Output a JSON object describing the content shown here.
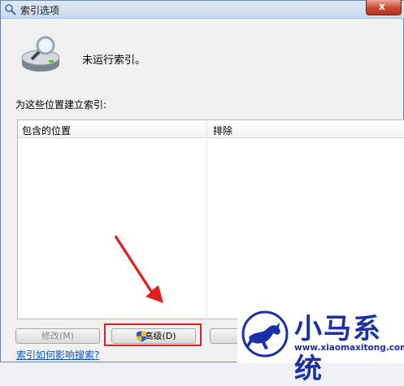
{
  "window": {
    "title": "索引选项",
    "close_glyph": "x"
  },
  "status": {
    "text": "未运行索引。",
    "icon": "drive-search-icon"
  },
  "locations": {
    "label": "为这些位置建立索引:",
    "columns": {
      "included": "包含的位置",
      "excluded": "排除"
    },
    "rows": []
  },
  "buttons": {
    "modify": "修改(M)",
    "advanced": "高级(D)",
    "third": ""
  },
  "links": {
    "help": "索引如何影响搜索?"
  },
  "annotation": {
    "highlight_color": "#e0201d"
  },
  "watermark": {
    "title": "小马系统",
    "url": "www.xiaomaxitong.com",
    "color": "#1a2fa8"
  }
}
